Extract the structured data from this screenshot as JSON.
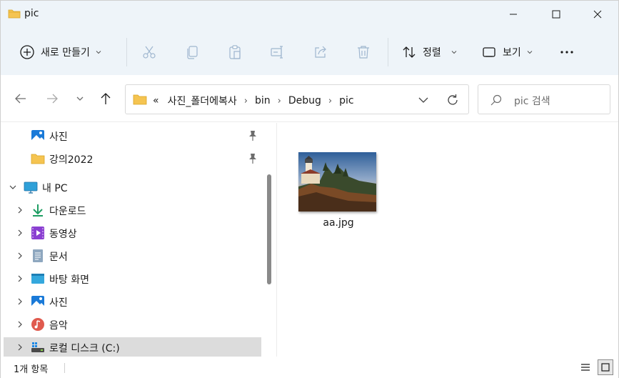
{
  "window": {
    "title": "pic",
    "icon": "folder-icon",
    "controls": [
      "minimize-icon",
      "maximize-icon",
      "close-icon"
    ]
  },
  "toolbar": {
    "new_label": "새로 만들기",
    "sort_label": "정렬",
    "view_label": "보기",
    "icons": [
      "add-circle-icon",
      "cut-icon",
      "copy-icon",
      "paste-icon",
      "rename-icon",
      "share-icon",
      "delete-icon",
      "sort-icon",
      "view-icon",
      "more-icon"
    ]
  },
  "address": {
    "overflow": "«",
    "crumbs": [
      "사진_폴더에복사",
      "bin",
      "Debug",
      "pic"
    ],
    "separator": "›"
  },
  "search": {
    "placeholder": "pic 검색"
  },
  "sidebar": {
    "items": [
      {
        "label": "사진",
        "icon": "photos-icon",
        "pinned": true
      },
      {
        "label": "강의2022",
        "icon": "folder-icon",
        "pinned": true
      },
      {
        "label": "내 PC",
        "icon": "pc-icon",
        "expanded": true
      },
      {
        "label": "다운로드",
        "icon": "download-icon"
      },
      {
        "label": "동영상",
        "icon": "videos-icon"
      },
      {
        "label": "문서",
        "icon": "documents-icon"
      },
      {
        "label": "바탕 화면",
        "icon": "desktop-icon"
      },
      {
        "label": "사진",
        "icon": "photos-icon"
      },
      {
        "label": "음악",
        "icon": "music-icon"
      },
      {
        "label": "로컬 디스크 (C:)",
        "icon": "drive-icon",
        "selected": true
      }
    ]
  },
  "files": [
    {
      "name": "aa.jpg",
      "thumbnail": "lighthouse-photo"
    }
  ],
  "status": {
    "count": "1개 항목"
  },
  "colors": {
    "chrome_bg": "#eef4f9",
    "folder": "#f5c451",
    "accent": "#0067c0",
    "selected_bg": "#dcdcdc"
  }
}
